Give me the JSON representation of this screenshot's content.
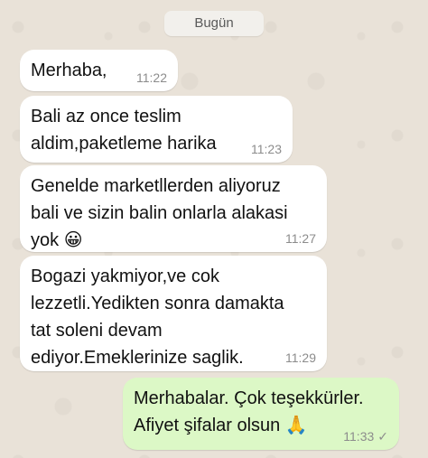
{
  "chat": {
    "date_label": "Bugün",
    "messages": [
      {
        "direction": "in",
        "text": "Merhaba,",
        "time": "11:22"
      },
      {
        "direction": "in",
        "text": "Bali az once teslim\naldim,paketleme harika",
        "time": "11:23"
      },
      {
        "direction": "in",
        "text": "Genelde marketllerden aliyoruz\nbali ve sizin balin onlarla alakasi\nyok",
        "emoji": "😀",
        "time": "11:27"
      },
      {
        "direction": "in",
        "text": "Bogazi yakmiyor,ve cok\nlezzetli.Yedikten sonra damakta\ntat soleni devam\nediyor.Emeklerinize saglik.",
        "time": "11:29"
      },
      {
        "direction": "out",
        "text": "Merhabalar. Çok teşekkürler.\nAfiyet şifalar olsun",
        "emoji": "🙏",
        "time": "11:33",
        "status_icon": "single-check-icon",
        "status_glyph": "✓"
      }
    ]
  }
}
